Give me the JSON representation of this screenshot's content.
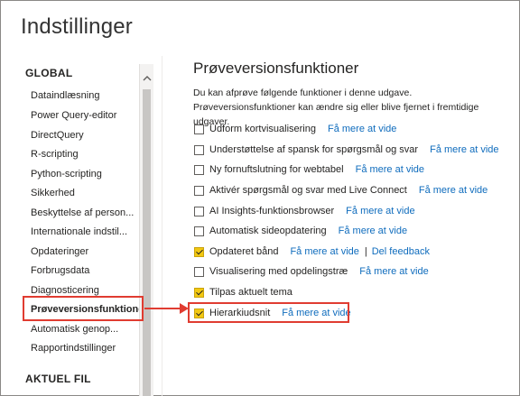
{
  "window": {
    "title": "Indstillinger"
  },
  "nav": {
    "global_header": "GLOBAL",
    "items": [
      "Dataindlæsning",
      "Power Query-editor",
      "DirectQuery",
      "R-scripting",
      "Python-scripting",
      "Sikkerhed",
      "Beskyttelse af person...",
      "Internationale indstil...",
      "Opdateringer",
      "Forbrugsdata",
      "Diagnosticering",
      "Prøveversionsfunktioner",
      "Automatisk genop...",
      "Rapportindstillinger"
    ],
    "current_file_header": "AKTUEL FIL"
  },
  "main": {
    "title": "Prøveversionsfunktioner",
    "description": "Du kan afprøve følgende funktioner i denne udgave. Prøveversionsfunktioner kan ændre sig eller blive fjernet i fremtidige udgaver.",
    "learn_more": "Få mere at vide",
    "feedback": "Del feedback",
    "features": [
      {
        "label": "Udform kortvisualisering",
        "checked": false
      },
      {
        "label": "Understøttelse af spansk for spørgsmål og svar",
        "checked": false
      },
      {
        "label": "Ny fornuftslutning for webtabel",
        "checked": false
      },
      {
        "label": "Aktivér spørgsmål og svar med Live Connect",
        "checked": false
      },
      {
        "label": "AI Insights-funktionsbrowser",
        "checked": false
      },
      {
        "label": "Automatisk sideopdatering",
        "checked": false
      },
      {
        "label": "Opdateret bånd",
        "checked": true
      },
      {
        "label": "Visualisering med opdelingstræ",
        "checked": false
      },
      {
        "label": "Tilpas aktuelt tema",
        "checked": true
      },
      {
        "label": "Hierarkiudsnit",
        "checked": true
      }
    ]
  },
  "colors": {
    "accent": "#f2c811",
    "link": "#0f6cbd",
    "highlight": "#e03c31"
  }
}
